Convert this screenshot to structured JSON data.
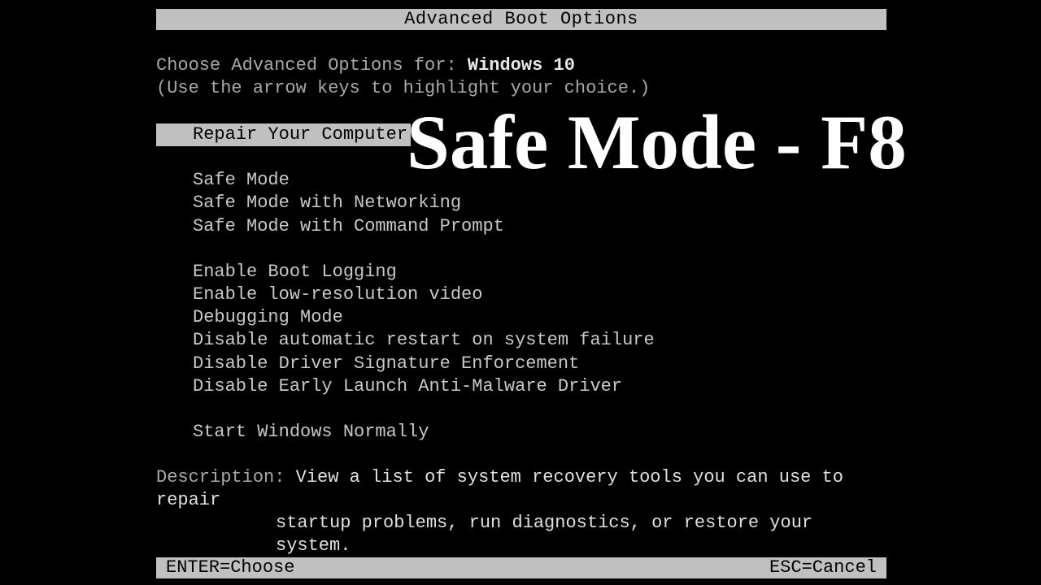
{
  "title": "Advanced Boot Options",
  "prompt": {
    "label": "Choose Advanced Options for: ",
    "os": "Windows 10"
  },
  "hint": "(Use the arrow keys to highlight your choice.)",
  "menu": {
    "selected_index": 0,
    "groups": [
      [
        "Repair Your Computer"
      ],
      [
        "Safe Mode",
        "Safe Mode with Networking",
        "Safe Mode with Command Prompt"
      ],
      [
        "Enable Boot Logging",
        "Enable low-resolution video",
        "Debugging Mode",
        "Disable automatic restart on system failure",
        "Disable Driver Signature Enforcement",
        "Disable Early Launch Anti-Malware Driver"
      ],
      [
        "Start Windows Normally"
      ]
    ]
  },
  "description": {
    "label": "Description: ",
    "line1": "View a list of system recovery tools you can use to repair",
    "line2": "startup problems, run diagnostics, or restore your system."
  },
  "footer": {
    "choose": "ENTER=Choose",
    "cancel": "ESC=Cancel"
  },
  "overlay": "Safe Mode - F8"
}
